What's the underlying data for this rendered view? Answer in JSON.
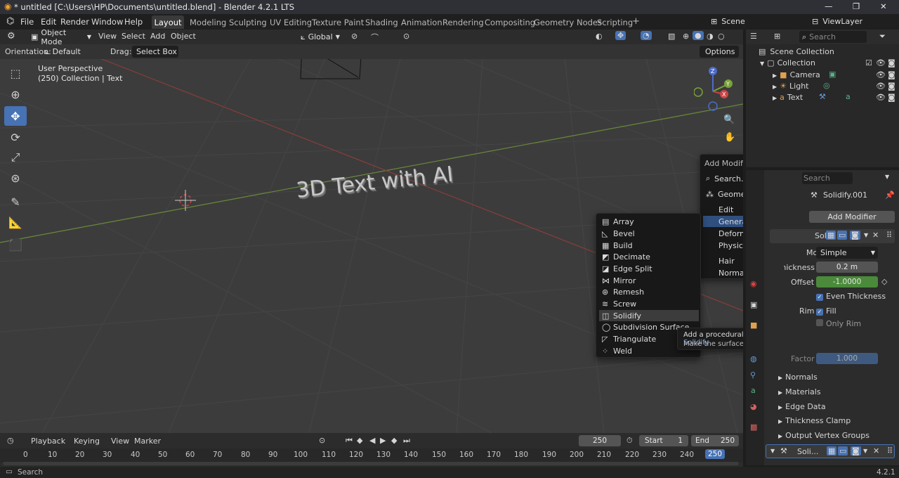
{
  "titlebar": {
    "title": "* untitled [C:\\Users\\HP\\Documents\\untitled.blend] - Blender 4.2.1 LTS",
    "min": "—",
    "max": "❐",
    "close": "✕"
  },
  "menubar": {
    "items": [
      "File",
      "Edit",
      "Render",
      "Window",
      "Help"
    ],
    "workspaces": [
      "Layout",
      "Modeling",
      "Sculpting",
      "UV Editing",
      "Texture Paint",
      "Shading",
      "Animation",
      "Rendering",
      "Compositing",
      "Geometry Nodes",
      "Scripting"
    ],
    "add_tab": "+",
    "scene": "Scene",
    "view_layer": "ViewLayer"
  },
  "viewport_header": {
    "mode": "Object Mode",
    "menus": [
      "View",
      "Select",
      "Add",
      "Object"
    ],
    "transform": "Global"
  },
  "tool_settings": {
    "orientation_label": "Orientation:",
    "orientation": "Default",
    "drag_label": "Drag:",
    "drag": "Select Box",
    "options": "Options"
  },
  "viewport": {
    "perspective": "User Perspective",
    "collection": "(250) Collection | Text",
    "text_object": "3D Text with AI"
  },
  "add_modifier_menu": {
    "title": "Add Modifier",
    "search": "Search...",
    "geometry_nodes": "Geometry Nodes",
    "items": [
      "Edit",
      "Generate",
      "Deform",
      "Physics"
    ],
    "items2": [
      "Hair",
      "Normals"
    ]
  },
  "generate_menu": {
    "items": [
      "Array",
      "Bevel",
      "Build",
      "Decimate",
      "Edge Split",
      "Mirror",
      "Remesh",
      "Screw",
      "Solidify",
      "Subdivision Surface",
      "Triangulate",
      "Weld"
    ]
  },
  "tooltip": {
    "line1": "Add a procedural operation/effect to the active object:",
    "highlight": "Solidify",
    "line2": "Make the surface thick"
  },
  "outliner": {
    "search_placeholder": "Search",
    "scene_collection": "Scene Collection",
    "collection": "Collection",
    "objects": [
      "Camera",
      "Light",
      "Text"
    ]
  },
  "properties": {
    "search_placeholder": "Search",
    "modifier_name": "Solidify.001",
    "add_modifier": "Add Modifier",
    "panel_name": "Soli",
    "mode_label": "Mode",
    "mode_value": "Simple",
    "thickness_label": "Thickness",
    "thickness_value": "0.2 m",
    "offset_label": "Offset",
    "offset_value": "-1.0000",
    "even_thickness": "Even Thickness",
    "rim_label": "Rim",
    "fill": "Fill",
    "only_rim": "Only Rim",
    "factor_label": "Factor",
    "factor_value": "1.000",
    "sections": [
      "Normals",
      "Materials",
      "Edge Data",
      "Thickness Clamp",
      "Output Vertex Groups"
    ],
    "panel2_name": "Soli..."
  },
  "timeline": {
    "menus": [
      "Playback",
      "Keying",
      "View",
      "Marker"
    ],
    "current_frame": "250",
    "start_label": "Start",
    "start": "1",
    "end_label": "End",
    "end": "250",
    "frames": [
      "0",
      "10",
      "20",
      "30",
      "40",
      "50",
      "60",
      "70",
      "80",
      "90",
      "100",
      "110",
      "120",
      "130",
      "140",
      "150",
      "160",
      "170",
      "180",
      "190",
      "200",
      "210",
      "220",
      "230",
      "240",
      "250"
    ]
  },
  "statusbar": {
    "search": "Search",
    "version": "4.2.1"
  },
  "colors": {
    "accent": "#4772b3",
    "offset_field": "#4a8a3a",
    "highlight": "#2f4f7f",
    "factor_field": "#3f5a80"
  }
}
